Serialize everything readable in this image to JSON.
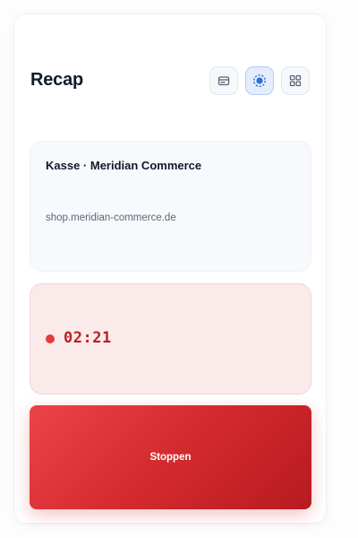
{
  "header": {
    "title": "Recap",
    "modes": [
      {
        "icon": "card-icon",
        "active": false
      },
      {
        "icon": "record-icon",
        "active": true
      },
      {
        "icon": "grid-icon",
        "active": false
      }
    ]
  },
  "site": {
    "name": "Kasse · Meridian Commerce",
    "url": "shop.meridian-commerce.de"
  },
  "recording": {
    "elapsed": "02:21",
    "indicator_color": "#e23d3d"
  },
  "actions": {
    "stop_label": "Stoppen"
  },
  "colors": {
    "accent": "#2f6fd6",
    "danger": "#d42a2e",
    "text": "#111a2e"
  }
}
